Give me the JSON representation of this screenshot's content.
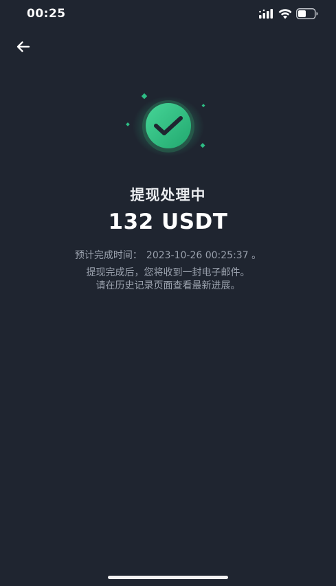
{
  "status_bar": {
    "time": "00:25"
  },
  "result": {
    "title": "提现处理中",
    "amount": "132 USDT",
    "eta_label": "预计完成时间：",
    "eta_value": "2023-10-26 00:25:37",
    "eta_suffix": " 。",
    "note_line1": "提现完成后，您将收到一封电子邮件。",
    "note_line2": "请在历史记录页面查看最新进展。"
  },
  "colors": {
    "background": "#1f2530",
    "accent_green": "#2ebd85",
    "check_mark": "#1f2530"
  },
  "icons": {
    "back": "arrow-left-icon",
    "success": "check-circle-icon"
  }
}
